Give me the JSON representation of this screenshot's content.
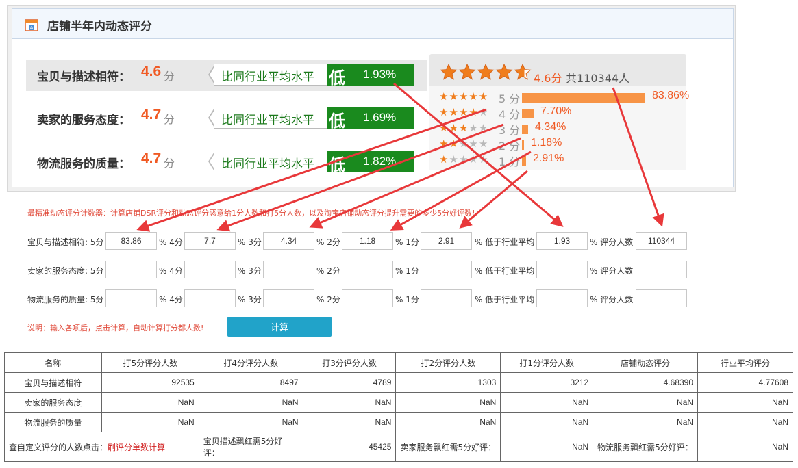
{
  "panel": {
    "title": "店铺半年内动态评分",
    "rows": [
      {
        "label": "宝贝与描述相符：",
        "score": "4.6",
        "unit": "分",
        "compare_text": "比同行业平均水平",
        "compare_level": "低",
        "compare_pct": "1.93%"
      },
      {
        "label": "卖家的服务态度：",
        "score": "4.7",
        "unit": "分",
        "compare_text": "比同行业平均水平",
        "compare_level": "低",
        "compare_pct": "1.69%"
      },
      {
        "label": "物流服务的质量：",
        "score": "4.7",
        "unit": "分",
        "compare_text": "比同行业平均水平",
        "compare_level": "低",
        "compare_pct": "1.82%"
      }
    ],
    "distribution": {
      "summary_score": "4.6分",
      "summary_total": "共110344人",
      "rating": 4.6,
      "levels": [
        {
          "label": "5 分",
          "pct": "83.86%",
          "value": 83.86,
          "stars": 5
        },
        {
          "label": "4 分",
          "pct": "7.70%",
          "value": 7.7,
          "stars": 4
        },
        {
          "label": "3 分",
          "pct": "4.34%",
          "value": 4.34,
          "stars": 3
        },
        {
          "label": "2 分",
          "pct": "1.18%",
          "value": 1.18,
          "stars": 2
        },
        {
          "label": "1 分",
          "pct": "2.91%",
          "value": 2.91,
          "stars": 1
        }
      ]
    }
  },
  "calculator": {
    "description": "最精准动态评分计数器：计算店铺DSR评分和动态评分恶意给1分人数和打5分人数，以及淘宝店铺动态评分提升需要的多少5分好评数!",
    "field_labels": {
      "p4": "% 4分",
      "p3": "% 3分",
      "p2": "% 2分",
      "p1": "% 1分",
      "below": "% 低于行业平均",
      "count": "% 评分人数"
    },
    "rows": [
      {
        "label": "宝贝与描述相符: 5分",
        "v5": "83.86",
        "v4": "7.7",
        "v3": "4.34",
        "v2": "1.18",
        "v1": "2.91",
        "below": "1.93",
        "count": "110344"
      },
      {
        "label": "卖家的服务态度: 5分",
        "v5": "",
        "v4": "",
        "v3": "",
        "v2": "",
        "v1": "",
        "below": "",
        "count": ""
      },
      {
        "label": "物流服务的质量: 5分",
        "v5": "",
        "v4": "",
        "v3": "",
        "v2": "",
        "v1": "",
        "below": "",
        "count": ""
      }
    ],
    "note": "说明：输入各项后，点击计算，自动计算打分都人数!",
    "button": "计算"
  },
  "results": {
    "headers": [
      "名称",
      "打5分评分人数",
      "打4分评分人数",
      "打3分评分人数",
      "打2分评分人数",
      "打1分评分人数",
      "店铺动态评分",
      "行业平均评分"
    ],
    "rows": [
      {
        "name": "宝贝与描述相符",
        "c5": "92535",
        "c4": "8497",
        "c3": "4789",
        "c2": "1303",
        "c1": "3212",
        "dsr": "4.68390",
        "avg": "4.77608"
      },
      {
        "name": "卖家的服务态度",
        "c5": "NaN",
        "c4": "NaN",
        "c3": "NaN",
        "c2": "NaN",
        "c1": "NaN",
        "dsr": "NaN",
        "avg": "NaN"
      },
      {
        "name": "物流服务的质量",
        "c5": "NaN",
        "c4": "NaN",
        "c3": "NaN",
        "c2": "NaN",
        "c1": "NaN",
        "dsr": "NaN",
        "avg": "NaN"
      }
    ],
    "footer": {
      "custom_label": "查自定义评分的人数点击：",
      "custom_link": "刷评分单数计算",
      "desc_label": "宝贝描述飘红需5分好评：",
      "desc_value": "45425",
      "service_label": "卖家服务飘红需5分好评：",
      "service_value": "NaN",
      "logistics_label": "物流服务飘红需5分好评：",
      "logistics_value": "NaN"
    }
  },
  "colors": {
    "accent_orange": "#f05a24",
    "bar_orange": "#f79446",
    "green": "#1a8a1e",
    "arrow_red": "#e8383a",
    "button_blue": "#21a3c9"
  }
}
